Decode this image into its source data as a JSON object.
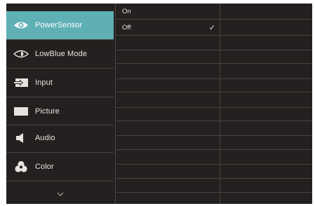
{
  "menu": {
    "items": [
      {
        "label": "PowerSensor",
        "icon": "power-sensor-icon",
        "active": true
      },
      {
        "label": "LowBlue Mode",
        "icon": "low-blue-eye-icon",
        "active": false
      },
      {
        "label": "Input",
        "icon": "input-icon",
        "active": false
      },
      {
        "label": "Picture",
        "icon": "picture-icon",
        "active": false
      },
      {
        "label": "Audio",
        "icon": "speaker-icon",
        "active": false
      },
      {
        "label": "Color",
        "icon": "color-palette-icon",
        "active": false
      }
    ],
    "more_icon": "chevron-down-icon"
  },
  "submenu": {
    "options": [
      {
        "label": "On",
        "selected": false
      },
      {
        "label": "Off",
        "selected": true
      }
    ],
    "check_glyph": "✓"
  },
  "colors": {
    "background": "#24201f",
    "accent": "#5fb0b4",
    "divider": "#4a4543",
    "text": "#e7e3e1"
  }
}
